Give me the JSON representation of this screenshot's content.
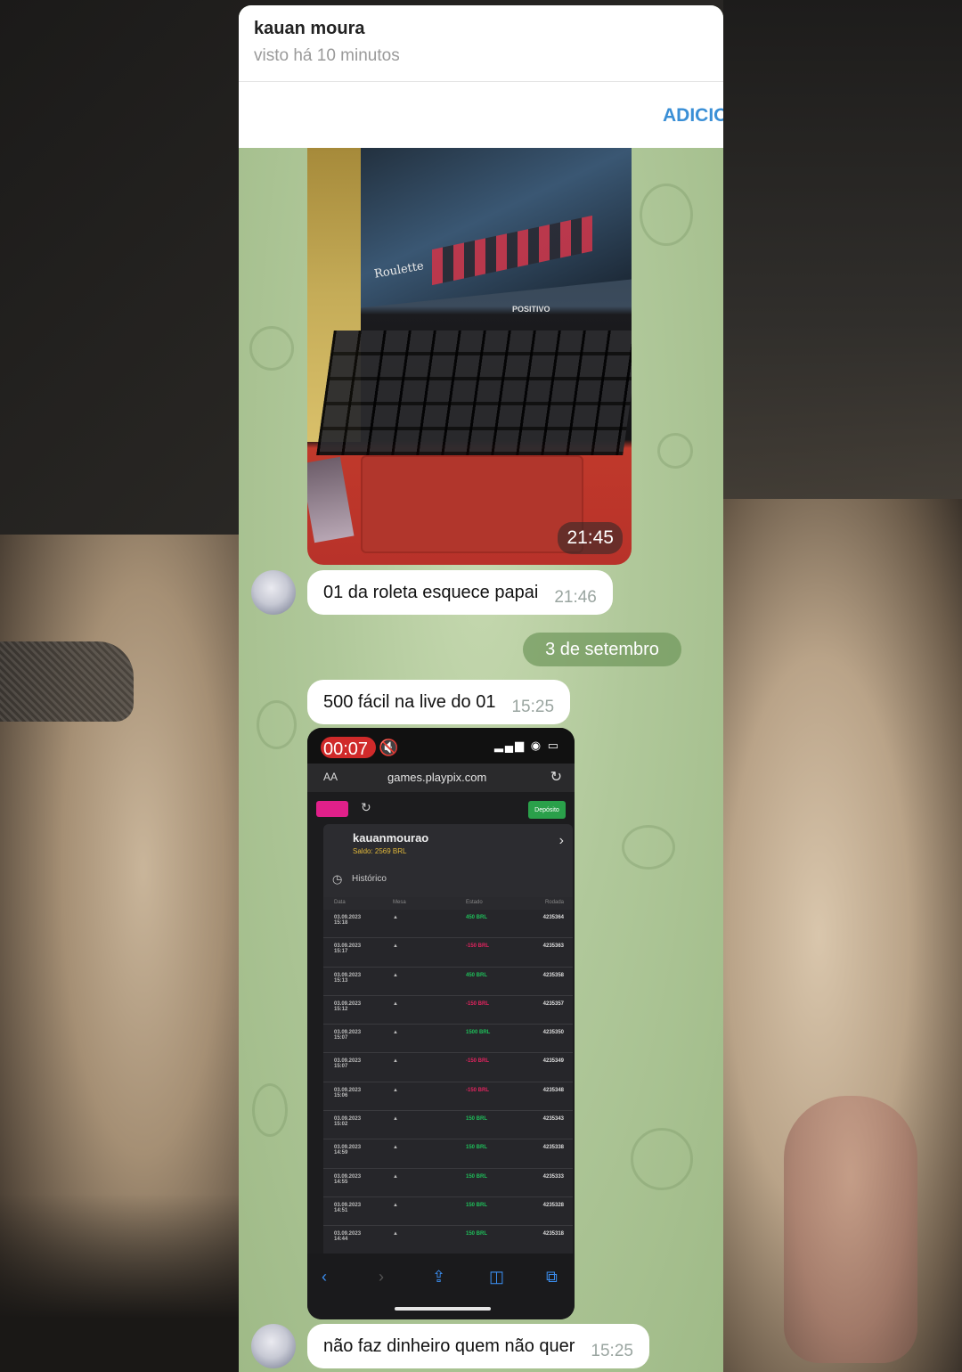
{
  "header": {
    "contact_name": "kauan moura",
    "status": "visto há 10 minutos"
  },
  "add_bar": {
    "label": "ADICIONAR"
  },
  "messages": [
    {
      "type": "photo",
      "time": "21:45"
    },
    {
      "type": "text",
      "text": "01 da roleta esquece papai",
      "time": "21:46"
    },
    {
      "type": "date",
      "text": "3 de setembro"
    },
    {
      "type": "text",
      "text": "500 fácil na live do 01",
      "time": "15:25"
    },
    {
      "type": "video",
      "recording_time": "00:07"
    },
    {
      "type": "text",
      "text": "não faz dinheiro quem não quer",
      "time": "15:25"
    }
  ],
  "laptop_photo": {
    "screen_label": "Roulette",
    "brand": "POSITIVO"
  },
  "phone_recording": {
    "recording_time": "00:07",
    "url_aa": "AA",
    "url": "games.playpix.com",
    "deposit_label": "Depósito",
    "username": "kauanmourao",
    "balance": "Saldo: 2569 BRL",
    "history_label": "Histórico",
    "columns": [
      "Data",
      "Mesa",
      "Estado",
      "Rodada"
    ],
    "rows": [
      {
        "date": "03.09.2023 15:18",
        "mesa": "▲",
        "state": "450 BRL",
        "state_color": "#1fbf5a",
        "round": "4235364"
      },
      {
        "date": "03.09.2023 15:17",
        "mesa": "▲",
        "state": "-150 BRL",
        "state_color": "#e0245e",
        "round": "4235363"
      },
      {
        "date": "03.09.2023 15:13",
        "mesa": "▲",
        "state": "450 BRL",
        "state_color": "#1fbf5a",
        "round": "4235358"
      },
      {
        "date": "03.09.2023 15:12",
        "mesa": "▲",
        "state": "-150 BRL",
        "state_color": "#e0245e",
        "round": "4235357"
      },
      {
        "date": "03.09.2023 15:07",
        "mesa": "▲",
        "state": "1500 BRL",
        "state_color": "#1fbf5a",
        "round": "4235350"
      },
      {
        "date": "03.09.2023 15:07",
        "mesa": "▲",
        "state": "-150 BRL",
        "state_color": "#e0245e",
        "round": "4235349"
      },
      {
        "date": "03.09.2023 15:06",
        "mesa": "▲",
        "state": "-150 BRL",
        "state_color": "#e0245e",
        "round": "4235348"
      },
      {
        "date": "03.09.2023 15:02",
        "mesa": "▲",
        "state": "150 BRL",
        "state_color": "#1fbf5a",
        "round": "4235343"
      },
      {
        "date": "03.09.2023 14:59",
        "mesa": "▲",
        "state": "150 BRL",
        "state_color": "#1fbf5a",
        "round": "4235338"
      },
      {
        "date": "03.09.2023 14:55",
        "mesa": "▲",
        "state": "150 BRL",
        "state_color": "#1fbf5a",
        "round": "4235333"
      },
      {
        "date": "03.09.2023 14:51",
        "mesa": "▲",
        "state": "150 BRL",
        "state_color": "#1fbf5a",
        "round": "4235328"
      },
      {
        "date": "03.09.2023 14:44",
        "mesa": "▲",
        "state": "150 BRL",
        "state_color": "#1fbf5a",
        "round": "4235318"
      }
    ]
  },
  "icons": {
    "mute": "speaker-mute-icon",
    "reload": "reload-icon",
    "back": "back-icon",
    "forward": "forward-icon",
    "share": "share-icon",
    "bookmarks": "bookmarks-icon",
    "tabs": "tabs-icon"
  },
  "colors": {
    "chat_background": "#a7c18e",
    "link_blue": "#3a8fd6",
    "win_green": "#1fbf5a",
    "loss_red": "#e0245e"
  }
}
